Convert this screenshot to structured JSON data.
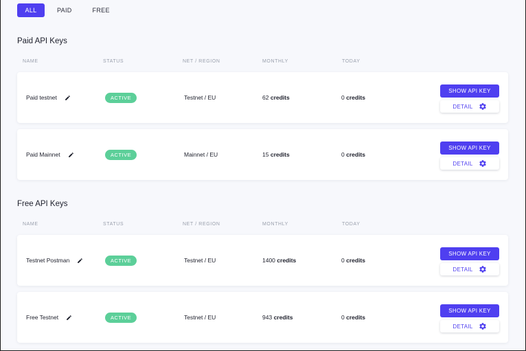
{
  "filters": [
    {
      "label": "ALL",
      "active": true
    },
    {
      "label": "PAID",
      "active": false
    },
    {
      "label": "FREE",
      "active": false
    }
  ],
  "columns": {
    "name": "NAME",
    "status": "STATUS",
    "net_region": "NET / REGION",
    "monthly": "MONTHLY",
    "today": "TODAY"
  },
  "credits_unit": "credits",
  "buttons": {
    "show_api_key": "SHOW API KEY",
    "detail": "DETAIL"
  },
  "colors": {
    "accent": "#4f3ff0",
    "active_badge": "#5ccf99"
  },
  "paid_section": {
    "title": "Paid API Keys",
    "keys": [
      {
        "name": "Paid testnet",
        "status": "ACTIVE",
        "net_region": "Testnet / EU",
        "monthly": "62",
        "today": "0"
      },
      {
        "name": "Paid Mainnet",
        "status": "ACTIVE",
        "net_region": "Mainnet / EU",
        "monthly": "15",
        "today": "0"
      }
    ]
  },
  "free_section": {
    "title": "Free API Keys",
    "keys": [
      {
        "name": "Testnet Postman",
        "status": "ACTIVE",
        "net_region": "Testnet / EU",
        "monthly": "1400",
        "today": "0"
      },
      {
        "name": "Free Testnet",
        "status": "ACTIVE",
        "net_region": "Testnet / EU",
        "monthly": "943",
        "today": "0"
      }
    ]
  }
}
